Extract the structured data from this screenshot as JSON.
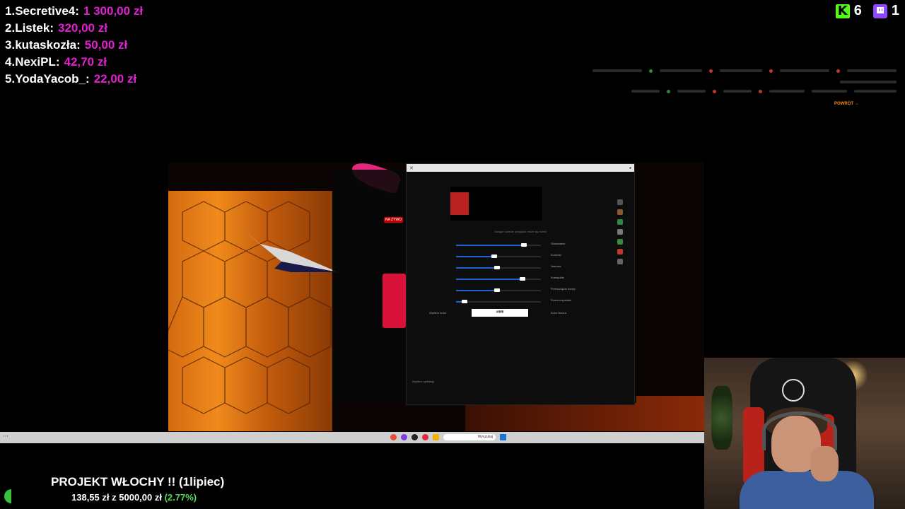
{
  "leaderboard": [
    {
      "rank": "1.",
      "name": "Secretive4:",
      "amount": "1 300,00 zł"
    },
    {
      "rank": "2.",
      "name": "Listek:",
      "amount": "320,00 zł"
    },
    {
      "rank": "3.",
      "name": "kutaskozła:",
      "amount": "50,00 zł"
    },
    {
      "rank": "4.",
      "name": "NexiPL:",
      "amount": "42,70 zł"
    },
    {
      "rank": "5.",
      "name": "YodaYacob_:",
      "amount": "22,00 zł"
    }
  ],
  "counters": {
    "kick": {
      "icon": "kick-icon",
      "value": "6",
      "color": "#53fc18"
    },
    "twitch": {
      "icon": "twitch-icon",
      "value": "1",
      "color": "#9146ff"
    }
  },
  "browser": {
    "back_link": "POWRÓT →"
  },
  "scene": {
    "live_tag": "NA ŻYWO"
  },
  "dialog": {
    "preview_hint": "Uwaga: rozmiar podglądu może się różnić",
    "sliders": [
      {
        "label": "Skalowanie",
        "value": 0.8
      },
      {
        "label": "Kontrast",
        "value": 0.45
      },
      {
        "label": "Jasność",
        "value": 0.48
      },
      {
        "label": "Krawędzie",
        "value": 0.78
      },
      {
        "label": "Przesunięcie barwy",
        "value": 0.48
      },
      {
        "label": "Przezroczystość",
        "value": 0.1
      }
    ],
    "color_label_left": "Wybierz kolor",
    "color_value": "#ffffff",
    "color_label_right": "Kolor klucza",
    "bottom_label": "Wybierz aplikację"
  },
  "taskbar": {
    "search_text": "Wyszukaj"
  },
  "goal": {
    "title": "PROJEKT WŁOCHY !! (1lipiec)",
    "raised": "138,55 zł",
    "separator": "z",
    "target": "5000,00 zł",
    "percent": "(2.77%)",
    "progress_fraction": 0.0277
  }
}
